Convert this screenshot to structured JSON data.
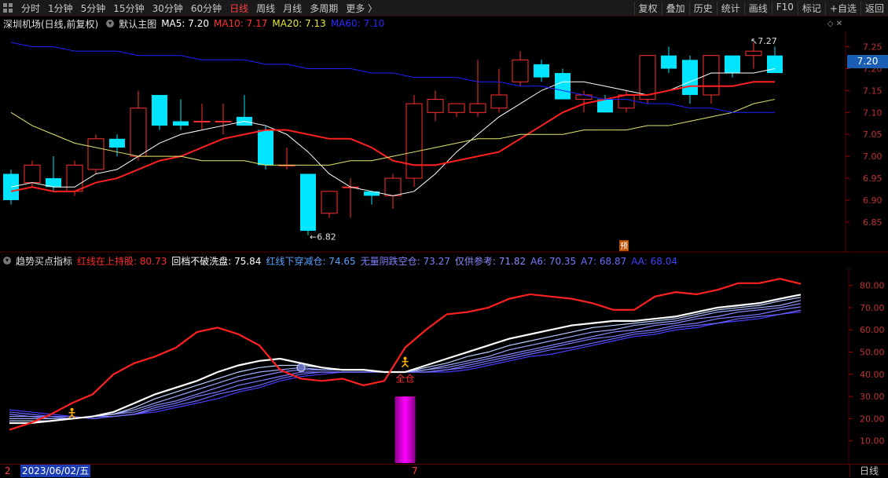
{
  "topbar": {
    "left_tabs": [
      "分时",
      "1分钟",
      "5分钟",
      "15分钟",
      "30分钟",
      "60分钟",
      "日线",
      "周线",
      "月线",
      "多周期",
      "更多 〉"
    ],
    "active_tab": "日线",
    "right_buttons": [
      "复权",
      "叠加",
      "历史",
      "统计",
      "画线",
      "F10",
      "标记",
      "+自选",
      "返回"
    ]
  },
  "infobar": {
    "stock": "深圳机场(日线,前复权)",
    "template": "默认主图",
    "ma5": "MA5: 7.20",
    "ma10": "MA10: 7.17",
    "ma20": "MA20: 7.13",
    "ma60": "MA60: 7.10"
  },
  "price_box": "7.20",
  "labels": {
    "low": "6.82",
    "high": "7.27",
    "yu": "预",
    "quancang": "全仓"
  },
  "indicator_bar": {
    "name": "趋势买点指标",
    "items": [
      {
        "text": "红线在上持股: 80.73",
        "color": "#ff2a2a"
      },
      {
        "text": "回档不破洗盘: 75.84",
        "color": "#ffffff"
      },
      {
        "text": "红线下穿减仓: 74.65",
        "color": "#5aa0ff"
      },
      {
        "text": "无量阴跌空仓: 73.27",
        "color": "#8080ff"
      },
      {
        "text": "仅供参考: 71.82",
        "color": "#8a8aff"
      },
      {
        "text": "A6: 70.35",
        "color": "#7a7aff"
      },
      {
        "text": "A7: 68.87",
        "color": "#6a6aff"
      },
      {
        "text": "AA: 68.04",
        "color": "#4040ff"
      }
    ]
  },
  "bottombar": {
    "date": "2023/06/02/五",
    "start_mark": "2",
    "mid_mark": "7",
    "right": "日线"
  },
  "chart_data": [
    {
      "type": "candlestick",
      "title": "深圳机场(日线,前复权)",
      "y_ticks": [
        6.85,
        6.9,
        6.95,
        7.0,
        7.05,
        7.1,
        7.15,
        7.2,
        7.25
      ],
      "ylim": [
        6.78,
        7.285
      ],
      "candles": [
        {
          "o": 6.96,
          "h": 6.97,
          "l": 6.89,
          "c": 6.9
        },
        {
          "o": 6.94,
          "h": 6.99,
          "l": 6.93,
          "c": 6.98
        },
        {
          "o": 6.95,
          "h": 7.0,
          "l": 6.92,
          "c": 6.93
        },
        {
          "o": 6.92,
          "h": 6.99,
          "l": 6.91,
          "c": 6.98
        },
        {
          "o": 6.97,
          "h": 7.05,
          "l": 6.96,
          "c": 7.04
        },
        {
          "o": 7.04,
          "h": 7.05,
          "l": 7.0,
          "c": 7.02
        },
        {
          "o": 7.0,
          "h": 7.15,
          "l": 6.99,
          "c": 7.11
        },
        {
          "o": 7.14,
          "h": 7.14,
          "l": 7.06,
          "c": 7.07
        },
        {
          "o": 7.08,
          "h": 7.13,
          "l": 7.06,
          "c": 7.07
        },
        {
          "o": 7.08,
          "h": 7.12,
          "l": 7.06,
          "c": 7.08
        },
        {
          "o": 7.08,
          "h": 7.12,
          "l": 7.05,
          "c": 7.08
        },
        {
          "o": 7.09,
          "h": 7.14,
          "l": 7.07,
          "c": 7.07
        },
        {
          "o": 7.06,
          "h": 7.07,
          "l": 6.97,
          "c": 6.98
        },
        {
          "o": 6.98,
          "h": 7.02,
          "l": 6.97,
          "c": 6.98
        },
        {
          "o": 6.96,
          "h": 6.96,
          "l": 6.82,
          "c": 6.83
        },
        {
          "o": 6.87,
          "h": 6.92,
          "l": 6.86,
          "c": 6.92
        },
        {
          "o": 6.93,
          "h": 6.95,
          "l": 6.86,
          "c": 6.93
        },
        {
          "o": 6.92,
          "h": 6.92,
          "l": 6.89,
          "c": 6.91
        },
        {
          "o": 6.91,
          "h": 6.96,
          "l": 6.88,
          "c": 6.95
        },
        {
          "o": 6.95,
          "h": 7.14,
          "l": 6.93,
          "c": 7.12
        },
        {
          "o": 7.1,
          "h": 7.15,
          "l": 7.08,
          "c": 7.13
        },
        {
          "o": 7.1,
          "h": 7.12,
          "l": 7.09,
          "c": 7.12
        },
        {
          "o": 7.1,
          "h": 7.22,
          "l": 7.09,
          "c": 7.12
        },
        {
          "o": 7.11,
          "h": 7.2,
          "l": 7.1,
          "c": 7.14
        },
        {
          "o": 7.17,
          "h": 7.24,
          "l": 7.16,
          "c": 7.22
        },
        {
          "o": 7.21,
          "h": 7.22,
          "l": 7.17,
          "c": 7.18
        },
        {
          "o": 7.19,
          "h": 7.2,
          "l": 7.13,
          "c": 7.13
        },
        {
          "o": 7.13,
          "h": 7.15,
          "l": 7.1,
          "c": 7.14
        },
        {
          "o": 7.13,
          "h": 7.14,
          "l": 7.1,
          "c": 7.1
        },
        {
          "o": 7.11,
          "h": 7.15,
          "l": 7.1,
          "c": 7.14
        },
        {
          "o": 7.13,
          "h": 7.23,
          "l": 7.12,
          "c": 7.23
        },
        {
          "o": 7.23,
          "h": 7.25,
          "l": 7.19,
          "c": 7.2
        },
        {
          "o": 7.22,
          "h": 7.23,
          "l": 7.12,
          "c": 7.14
        },
        {
          "o": 7.14,
          "h": 7.23,
          "l": 7.12,
          "c": 7.23
        },
        {
          "o": 7.23,
          "h": 7.23,
          "l": 7.18,
          "c": 7.19
        },
        {
          "o": 7.23,
          "h": 7.26,
          "l": 7.2,
          "c": 7.24
        },
        {
          "o": 7.23,
          "h": 7.25,
          "l": 7.19,
          "c": 7.19
        }
      ],
      "series": [
        {
          "name": "MA5",
          "color": "#ffffff",
          "values": [
            6.93,
            6.94,
            6.93,
            6.93,
            6.96,
            6.97,
            7.0,
            7.03,
            7.05,
            7.06,
            7.07,
            7.08,
            7.07,
            7.05,
            7.01,
            6.96,
            6.93,
            6.92,
            6.91,
            6.92,
            6.96,
            7.01,
            7.05,
            7.09,
            7.12,
            7.15,
            7.17,
            7.17,
            7.16,
            7.15,
            7.14,
            7.15,
            7.17,
            7.19,
            7.19,
            7.19,
            7.2
          ]
        },
        {
          "name": "MA10",
          "color": "#ff2020",
          "values": [
            6.92,
            6.93,
            6.92,
            6.92,
            6.94,
            6.95,
            6.97,
            6.99,
            7.0,
            7.02,
            7.04,
            7.05,
            7.06,
            7.06,
            7.05,
            7.04,
            7.04,
            7.02,
            6.99,
            6.98,
            6.98,
            6.99,
            7.0,
            7.01,
            7.04,
            7.07,
            7.1,
            7.12,
            7.13,
            7.14,
            7.14,
            7.15,
            7.16,
            7.16,
            7.16,
            7.17,
            7.17
          ]
        },
        {
          "name": "MA20",
          "color": "#e8e870",
          "values": [
            7.1,
            7.07,
            7.05,
            7.03,
            7.02,
            7.01,
            7.0,
            7.0,
            7.0,
            6.99,
            6.99,
            6.99,
            6.98,
            6.98,
            6.98,
            6.98,
            6.99,
            6.99,
            7.0,
            7.01,
            7.02,
            7.03,
            7.04,
            7.04,
            7.05,
            7.05,
            7.05,
            7.06,
            7.06,
            7.06,
            7.07,
            7.07,
            7.08,
            7.09,
            7.1,
            7.12,
            7.13
          ]
        },
        {
          "name": "MA60",
          "color": "#2020ff",
          "values": [
            7.26,
            7.25,
            7.25,
            7.24,
            7.24,
            7.24,
            7.23,
            7.23,
            7.23,
            7.22,
            7.22,
            7.22,
            7.21,
            7.21,
            7.2,
            7.2,
            7.2,
            7.19,
            7.19,
            7.18,
            7.18,
            7.18,
            7.17,
            7.17,
            7.16,
            7.16,
            7.15,
            7.14,
            7.13,
            7.13,
            7.12,
            7.12,
            7.11,
            7.11,
            7.1,
            7.1,
            7.1
          ]
        }
      ]
    },
    {
      "type": "line",
      "title": "趋势买点指标",
      "y_ticks": [
        10,
        20,
        30,
        40,
        50,
        60,
        70,
        80
      ],
      "ylim": [
        0,
        88
      ],
      "series": [
        {
          "name": "红线在上持股",
          "color": "#ff2020",
          "values": [
            15,
            18,
            22,
            27,
            31,
            40,
            45,
            48,
            52,
            59,
            61,
            58,
            53,
            42,
            38,
            37,
            38,
            35,
            37,
            52,
            60,
            67,
            68,
            70,
            74,
            76,
            75,
            74,
            72,
            69,
            69,
            75,
            77,
            76,
            78,
            81,
            81,
            83,
            80.73
          ]
        },
        {
          "name": "回档不破洗盘",
          "color": "#ffffff",
          "values": [
            18,
            18,
            19,
            20,
            21,
            23,
            27,
            31,
            34,
            37,
            41,
            44,
            46,
            47,
            45,
            43,
            42,
            42,
            41,
            41,
            44,
            47,
            50,
            53,
            56,
            58,
            60,
            62,
            63,
            64,
            64,
            65,
            66,
            68,
            70,
            71,
            72,
            74,
            75.84
          ]
        },
        {
          "name": "红线下穿减仓",
          "color": "#bcd0ff",
          "values": [
            19,
            19,
            19,
            20,
            21,
            22,
            25,
            29,
            32,
            35,
            38,
            41,
            43,
            44,
            44,
            43,
            42,
            42,
            41,
            41,
            43,
            45,
            48,
            50,
            53,
            55,
            57,
            59,
            61,
            62,
            63,
            64,
            65,
            67,
            69,
            70,
            71,
            73,
            74.65
          ]
        },
        {
          "name": "无量阴跌空仓",
          "color": "#9aa8ff",
          "values": [
            20,
            20,
            20,
            20,
            21,
            22,
            24,
            27,
            30,
            33,
            36,
            39,
            41,
            42,
            43,
            42,
            42,
            42,
            41,
            41,
            42,
            44,
            46,
            48,
            51,
            53,
            55,
            57,
            59,
            60,
            62,
            63,
            64,
            66,
            68,
            69,
            70,
            71,
            73.27
          ]
        },
        {
          "name": "仅供参考",
          "color": "#8a8aff",
          "values": [
            21,
            21,
            20,
            20,
            21,
            22,
            23,
            26,
            28,
            31,
            34,
            37,
            39,
            41,
            42,
            42,
            42,
            42,
            41,
            41,
            42,
            43,
            45,
            47,
            49,
            51,
            53,
            55,
            57,
            59,
            60,
            62,
            63,
            65,
            66,
            68,
            69,
            70,
            71.82
          ]
        },
        {
          "name": "A6",
          "color": "#7a7aff",
          "values": [
            22,
            21,
            21,
            20,
            21,
            21,
            22,
            25,
            27,
            30,
            32,
            35,
            37,
            39,
            41,
            41,
            41,
            41,
            41,
            41,
            41,
            42,
            44,
            46,
            48,
            50,
            52,
            54,
            56,
            57,
            59,
            60,
            62,
            63,
            65,
            66,
            67,
            69,
            70.35
          ]
        },
        {
          "name": "A7",
          "color": "#6a6aff",
          "values": [
            23,
            22,
            21,
            21,
            20,
            21,
            22,
            24,
            26,
            28,
            31,
            33,
            35,
            38,
            40,
            41,
            41,
            41,
            41,
            41,
            41,
            42,
            43,
            45,
            47,
            49,
            51,
            52,
            54,
            56,
            58,
            59,
            61,
            62,
            63,
            65,
            66,
            67,
            68.87
          ]
        },
        {
          "name": "AA",
          "color": "#4a3cff",
          "values": [
            24,
            23,
            22,
            21,
            20,
            21,
            22,
            23,
            25,
            27,
            29,
            32,
            34,
            37,
            39,
            40,
            41,
            41,
            41,
            41,
            41,
            41,
            42,
            44,
            46,
            48,
            49,
            51,
            53,
            55,
            57,
            58,
            60,
            61,
            63,
            64,
            65,
            67,
            68.04
          ]
        }
      ],
      "bar": {
        "index": 19,
        "value": 30,
        "color": "#ff00ff"
      }
    }
  ]
}
